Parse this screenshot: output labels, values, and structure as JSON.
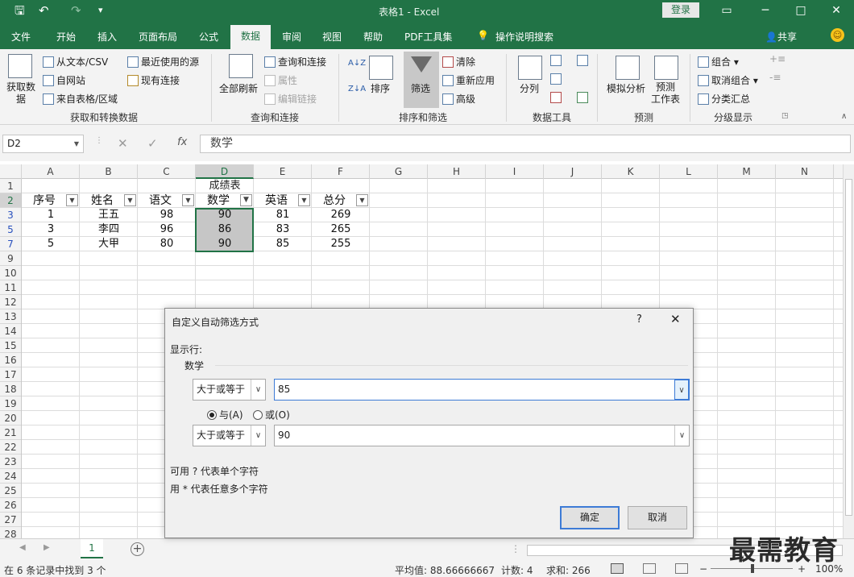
{
  "window": {
    "doc_title": "表格1 - Excel",
    "login_label": "登录",
    "min_glyph": "─",
    "restore_glyph": "□",
    "close_glyph": "✕",
    "ribbon_opt_glyph": "▭"
  },
  "quick_access": {
    "save_glyph": "🖫",
    "undo_glyph": "↶",
    "redo_glyph": "↷",
    "customize_glyph": "▾"
  },
  "tabs": [
    "文件",
    "开始",
    "插入",
    "页面布局",
    "公式",
    "数据",
    "审阅",
    "视图",
    "帮助",
    "PDF工具集",
    "操作说明搜索"
  ],
  "share_label": "共享",
  "ribbon": {
    "get_data": "获取数据",
    "from_text": "从文本/CSV",
    "from_web": "自网站",
    "from_table": "来自表格/区域",
    "recent_sources": "最近使用的源",
    "existing_conn": "现有连接",
    "group_get": "获取和转换数据",
    "refresh_all": "全部刷新",
    "queries_conn": "查询和连接",
    "properties": "属性",
    "edit_links": "编辑链接",
    "group_queries": "查询和连接",
    "sort": "排序",
    "filter": "筛选",
    "clear": "清除",
    "reapply": "重新应用",
    "advanced": "高级",
    "group_sort": "排序和筛选",
    "split": "分列",
    "group_tools": "数据工具",
    "whatif": "模拟分析",
    "forecast_sheet": "预测\n工作表",
    "group_forecast": "预测",
    "group_btn": "组合",
    "ungroup_btn": "取消组合",
    "subtotal": "分类汇总",
    "group_outline": "分级显示"
  },
  "formula_bar": {
    "name_box": "D2",
    "formula": "数学",
    "fx": "fx",
    "cancel": "✕",
    "enter": "✓"
  },
  "columns": [
    "A",
    "B",
    "C",
    "D",
    "E",
    "F",
    "G",
    "H",
    "I",
    "J",
    "K",
    "L",
    "M",
    "N"
  ],
  "rows": [
    "1",
    "2",
    "3",
    "5",
    "7",
    "9",
    "10",
    "11",
    "12",
    "13",
    "14",
    "15",
    "16",
    "17",
    "18",
    "19",
    "20",
    "21",
    "22",
    "23",
    "24",
    "25",
    "26",
    "27",
    "28"
  ],
  "table": {
    "title": "成绩表",
    "headers": [
      "序号",
      "姓名",
      "语文",
      "数学",
      "英语",
      "总分"
    ],
    "data": [
      [
        "1",
        "王五",
        "98",
        "90",
        "81",
        "269"
      ],
      [
        "3",
        "李四",
        "96",
        "86",
        "83",
        "265"
      ],
      [
        "5",
        "大甲",
        "80",
        "90",
        "85",
        "255"
      ]
    ]
  },
  "sheet": {
    "tab": "1",
    "add": "+"
  },
  "status": {
    "left": "在 6 条记录中找到 3 个",
    "average": "平均值: 88.66666667",
    "count": "计数: 4",
    "sum": "求和: 266",
    "zoom": "100%"
  },
  "dialog": {
    "title": "自定义自动筛选方式",
    "help": "?",
    "close": "✕",
    "show_rows": "显示行:",
    "field": "数学",
    "op1": "大于或等于",
    "val1": "85",
    "and_label": "与(A)",
    "or_label": "或(O)",
    "op2": "大于或等于",
    "val2": "90",
    "hint1": "可用 ? 代表单个字符",
    "hint2": "用 * 代表任意多个字符",
    "ok": "确定",
    "cancel": "取消"
  },
  "watermark": "最需教育"
}
